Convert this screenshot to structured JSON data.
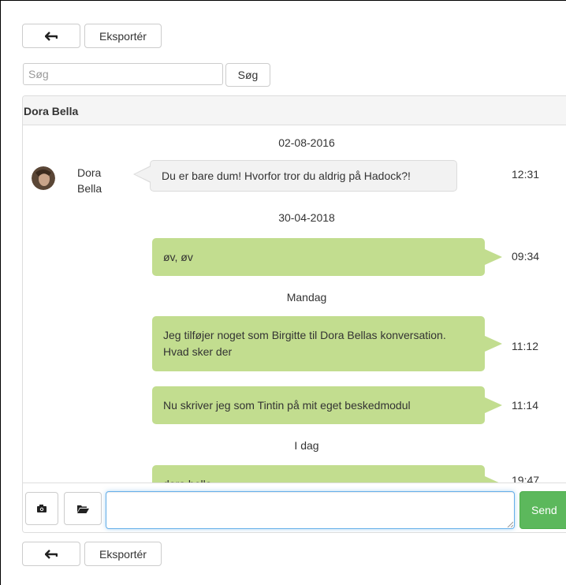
{
  "toolbar_top": {
    "back_icon": "back-arrow-icon",
    "export_label": "Eksportér"
  },
  "search": {
    "placeholder": "Søg",
    "value": "",
    "button_label": "Søg"
  },
  "conversation": {
    "title": "Dora Bella",
    "messages": [
      {
        "type": "date",
        "text": "02-08-2016"
      },
      {
        "type": "incoming",
        "sender": "Dora Bella",
        "text": "Du er bare dum! Hvorfor tror du aldrig på Hadock?!",
        "time": "12:31"
      },
      {
        "type": "date",
        "text": "30-04-2018"
      },
      {
        "type": "outgoing",
        "text": "øv, øv",
        "time": "09:34"
      },
      {
        "type": "date",
        "text": "Mandag"
      },
      {
        "type": "outgoing",
        "text": "Jeg tilføjer noget som Birgitte til Dora Bellas konversation. Hvad sker der",
        "time": "11:12"
      },
      {
        "type": "outgoing",
        "text": "Nu skriver jeg som Tintin på mit eget beskedmodul",
        "time": "11:14"
      },
      {
        "type": "date",
        "text": "I dag"
      },
      {
        "type": "outgoing",
        "text": "dora bella",
        "time": "19:47"
      }
    ]
  },
  "compose": {
    "camera_icon": "camera-icon",
    "folder_icon": "folder-open-icon",
    "value": "",
    "send_label": "Send",
    "send_color": "#5cb85c"
  },
  "toolbar_bottom": {
    "back_icon": "back-arrow-icon",
    "export_label": "Eksportér"
  },
  "colors": {
    "outgoing_bubble": "#c2dd8f",
    "incoming_bubble": "#f2f2f2"
  }
}
